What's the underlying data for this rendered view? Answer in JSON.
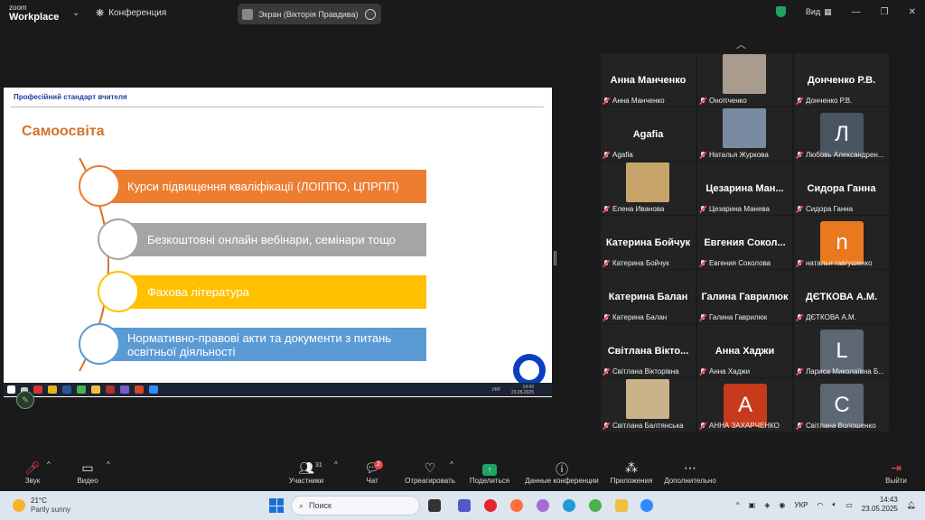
{
  "app": {
    "logo_line1": "zoom",
    "logo_line2": "Workplace",
    "conference_label": "Конференция"
  },
  "share": {
    "label": "Экран (Вікторія Правдива)",
    "more": "···"
  },
  "topright": {
    "view_label": "Вид"
  },
  "slide": {
    "header": "Професійний стандарт вчителя",
    "title": "Самоосвіта",
    "items": [
      {
        "text": "Курси підвищення кваліфікації (ЛОІППО, ЦПРПП)",
        "color": "#ed7d31"
      },
      {
        "text": "Безкоштовні онлайн вебінари, семінари тощо",
        "color": "#a5a5a5"
      },
      {
        "text": "Фахова література",
        "color": "#ffc000"
      },
      {
        "text": "Нормативно-правові акти та документи з питань освітньої діяльності",
        "color": "#5b9bd5"
      }
    ]
  },
  "remote_taskbar": {
    "lang": "УКР",
    "time": "14:43",
    "date": "23.05.2025"
  },
  "participants": [
    {
      "big": "Анна Манченко",
      "name": "Анна Манченко"
    },
    {
      "big": "",
      "name": "Оноπченко",
      "photo": "#a99b8d"
    },
    {
      "big": "Донченко Р.В.",
      "name": "Донченко Р.В."
    },
    {
      "big": "Agafia",
      "name": "Agafia"
    },
    {
      "big": "",
      "name": "Наталья Журкова",
      "photo": "#7a8aa0"
    },
    {
      "big": "",
      "name": "Любовь Александрен...",
      "avatar": "Л",
      "avatar_color": "#4a5562"
    },
    {
      "big": "",
      "name": "Елена Иванова",
      "photo": "#c7a56a"
    },
    {
      "big": "Цезарина Ман...",
      "name": "Цезарина Манева"
    },
    {
      "big": "Сидора Ганна",
      "name": "Сидора Ганна"
    },
    {
      "big": "Катерина Бойчук",
      "name": "Катерина Бойчук"
    },
    {
      "big": "Евгения Сокол...",
      "name": "Евгения Соколова"
    },
    {
      "big": "",
      "name": "наталья гавrушенко",
      "avatar": "n",
      "avatar_color": "#e8791e"
    },
    {
      "big": "Катерина Балан",
      "name": "Катерина Балан"
    },
    {
      "big": "Галина Гаврилюк",
      "name": "Галина Гаврилюк"
    },
    {
      "big": "ДЄТКОВА А.М.",
      "name": "ДЄТКОВА А.М."
    },
    {
      "big": "Світлана Вікто...",
      "name": "Світлана Вікторівна"
    },
    {
      "big": "Анна Хаджи",
      "name": "Анна Хаджи"
    },
    {
      "big": "",
      "name": "Лариса Миколаївна Б...",
      "avatar": "L",
      "avatar_color": "#5c6773"
    },
    {
      "big": "",
      "name": "Світлана Балтянська",
      "photo": "#c9b48a"
    },
    {
      "big": "",
      "name": "АННА ЗАХАРЧЕНКО",
      "avatar": "A",
      "avatar_color": "#c73b1c"
    },
    {
      "big": "",
      "name": "Світлана Волошенко",
      "avatar": "C",
      "avatar_color": "#5c6773"
    }
  ],
  "controls": {
    "audio": "Звук",
    "video": "Видео",
    "participants": "Участники",
    "participants_count": "31",
    "chat": "Чат",
    "chat_badge": "2",
    "react": "Отреагировать",
    "share": "Поделиться",
    "info": "Данные конференции",
    "apps": "Приложения",
    "more": "Дополнительно",
    "leave": "Выйти"
  },
  "taskbar": {
    "temp": "21°C",
    "weather": "Partly sunny",
    "search_placeholder": "Поиск",
    "lang": "УКР",
    "time": "14:43",
    "date": "23.05.2025"
  }
}
